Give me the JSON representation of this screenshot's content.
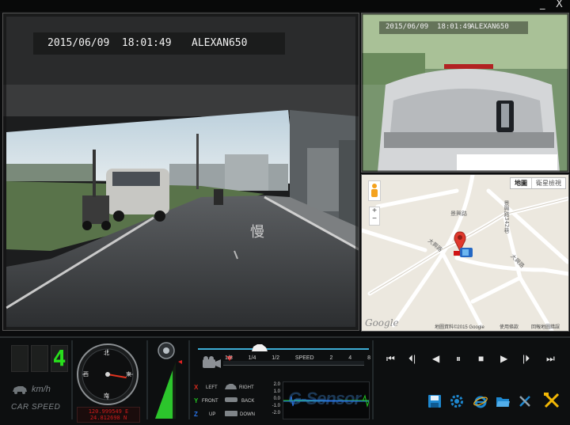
{
  "window": {
    "minimize_label": "_",
    "close_label": "X"
  },
  "main_camera": {
    "timestamp": "2015/06/09  18:01:49",
    "device": "ALEXAN650"
  },
  "rear_camera": {
    "timestamp": "2015/06/09  18:01:49",
    "device": "ALEXAN650"
  },
  "map": {
    "map_button": "地圖",
    "satellite_button": "衛星檢視",
    "zoom_in": "+",
    "zoom_out": "−",
    "road_labels": [
      "景興路",
      "景興路342巷",
      "大興路",
      "大興路"
    ],
    "watermark": "Google",
    "copyright": "地圖資料©2015 Google",
    "terms": "使用條款",
    "report": "回報地圖錯誤"
  },
  "speed": {
    "digits": [
      "",
      "",
      "4"
    ],
    "unit": "km/h",
    "label": "CAR SPEED"
  },
  "compass": {
    "north": "北",
    "east": "東",
    "south": "南",
    "west": "西",
    "scale_labels": [
      "3E",
      "1W"
    ],
    "heading_deg": 100,
    "latitude": "120.999549 E",
    "longitude": "24.812698 N"
  },
  "playback": {
    "speed_label": "SPEED",
    "speed_marks": [
      "1/8",
      "1/4",
      "1/2",
      "SPEED",
      "2",
      "4",
      "8"
    ],
    "progress": 0.36
  },
  "volume": {
    "level": 0.85
  },
  "gsensor": {
    "x_label": "X",
    "left": "LEFT",
    "right": "RIGHT",
    "y_label": "Y",
    "front": "FRONT",
    "back": "BACK",
    "z_label": "Z",
    "up": "UP",
    "down": "DOWN",
    "y_ticks": [
      "2.0",
      "1.0",
      "0.0",
      "-1.0",
      "-2.0"
    ],
    "watermark": "G-Sensor"
  },
  "colors": {
    "accent_blue": "#1e88d0",
    "digit_green": "#28e01c",
    "coord_red": "#d21b1b",
    "axis_x": "#d42a1e",
    "axis_y": "#22c522",
    "axis_z": "#2a74e8"
  }
}
